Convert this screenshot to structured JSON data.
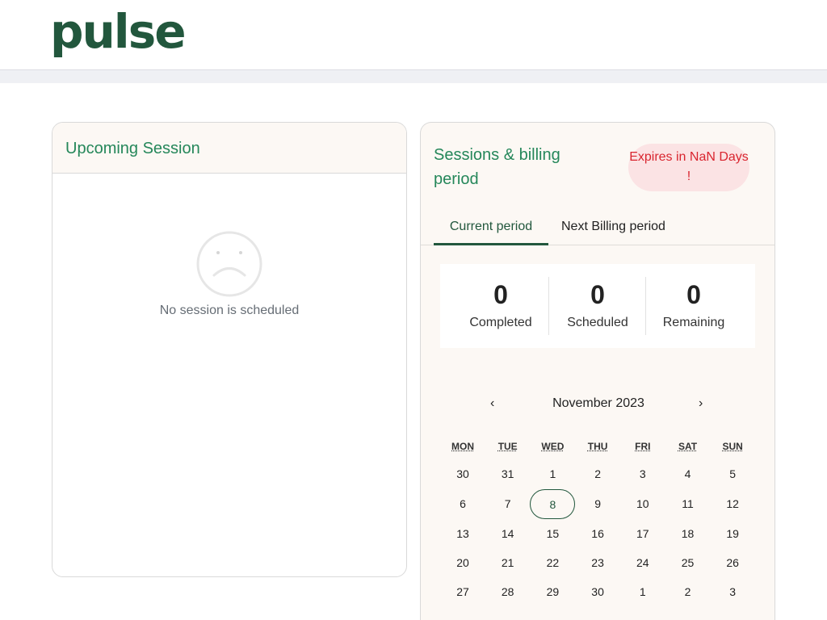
{
  "brand": {
    "logo_text": "pulse"
  },
  "upcoming": {
    "title": "Upcoming Session",
    "empty_message": "No session is scheduled",
    "empty_icon": "sad-face-icon"
  },
  "billing": {
    "title": "Sessions & billing period",
    "expires_badge": "Expires in NaN Days !",
    "tabs": [
      {
        "label": "Current period",
        "active": true
      },
      {
        "label": "Next Billing period",
        "active": false
      }
    ],
    "stats": [
      {
        "value": "0",
        "label": "Completed"
      },
      {
        "value": "0",
        "label": "Scheduled"
      },
      {
        "value": "0",
        "label": "Remaining"
      }
    ]
  },
  "calendar": {
    "prev_label": "‹",
    "next_label": "›",
    "month_label": "November 2023",
    "weekdays": [
      "MON",
      "TUE",
      "WED",
      "THU",
      "FRI",
      "SAT",
      "SUN"
    ],
    "weeks": [
      [
        "30",
        "31",
        "1",
        "2",
        "3",
        "4",
        "5"
      ],
      [
        "6",
        "7",
        "8",
        "9",
        "10",
        "11",
        "12"
      ],
      [
        "13",
        "14",
        "15",
        "16",
        "17",
        "18",
        "19"
      ],
      [
        "20",
        "21",
        "22",
        "23",
        "24",
        "25",
        "26"
      ],
      [
        "27",
        "28",
        "29",
        "30",
        "1",
        "2",
        "3"
      ]
    ],
    "today": "8"
  },
  "colors": {
    "brand_green": "#22573d",
    "title_green": "#25875a",
    "badge_red": "#d9252f",
    "badge_bg": "#fbe3e4",
    "card_header_bg": "#fcf8f4"
  }
}
